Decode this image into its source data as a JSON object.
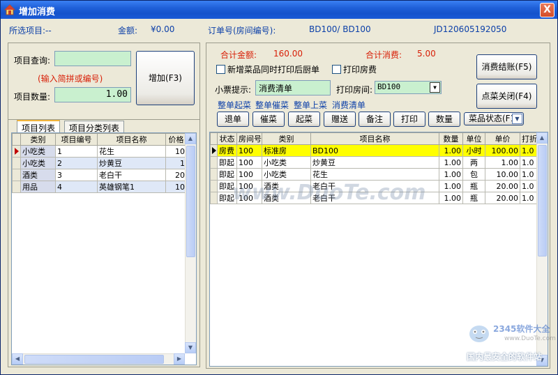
{
  "window": {
    "title": "增加消费",
    "close_label": "X"
  },
  "info": {
    "selected_item_label": "所选项目:--",
    "amount_label": "金额:",
    "amount_value": "¥0.00",
    "order_label": "订单号(房间编号):",
    "order_room": "BD100/ BD100",
    "order_id": "JD120605192050"
  },
  "left": {
    "query_label": "项目查询:",
    "query_value": "",
    "hint": "(输入简拼或编号)",
    "qty_label": "项目数量:",
    "qty_value": "1.00",
    "add_button": "增加(F3)",
    "tabs": [
      "项目列表",
      "项目分类列表"
    ],
    "columns": [
      "类别",
      "项目编号",
      "项目名称",
      "价格"
    ],
    "rows": [
      {
        "category": "小吃类",
        "id": "1",
        "name": "花生",
        "price": "10"
      },
      {
        "category": "小吃类",
        "id": "2",
        "name": "炒黄豆",
        "price": "1"
      },
      {
        "category": "酒类",
        "id": "3",
        "name": "老白干",
        "price": "20"
      },
      {
        "category": "用品",
        "id": "4",
        "name": "英雄钢笔1",
        "price": "10"
      }
    ]
  },
  "right": {
    "total_amount_label": "合计金额:",
    "total_amount_value": "160.00",
    "total_consume_label": "合计消费:",
    "total_consume_value": "5.00",
    "checkout_button": "消费结账(F5)",
    "close_menu_button": "点菜关闭(F4)",
    "print_after_kitchen_label": "新增菜品同时打印后厨单",
    "print_room_fee_label": "打印房费",
    "ticket_label": "小票提示:",
    "ticket_value": "消费清单",
    "print_room_label": "打印房间:",
    "print_room_value": "BD100",
    "links": [
      "整单起菜",
      "整单催菜",
      "整单上菜",
      "消费清单"
    ],
    "actions": [
      "退单",
      "催菜",
      "起菜",
      "赠送",
      "备注",
      "打印",
      "数量"
    ],
    "dish_state_label": "菜品状态(F1)",
    "columns": [
      "状态",
      "房间号",
      "类别",
      "项目名称",
      "数量",
      "单位",
      "单价",
      "打折"
    ],
    "rows": [
      {
        "status": "房费",
        "room": "100",
        "category": "标准房",
        "name": "BD100",
        "qty": "1.00",
        "unit": "小时",
        "price": "100.00",
        "discount": "1.0"
      },
      {
        "status": "即起",
        "room": "100",
        "category": "小吃类",
        "name": "炒黄豆",
        "qty": "1.00",
        "unit": "两",
        "price": "1.00",
        "discount": "1.0"
      },
      {
        "status": "即起",
        "room": "100",
        "category": "小吃类",
        "name": "花生",
        "qty": "1.00",
        "unit": "包",
        "price": "10.00",
        "discount": "1.0"
      },
      {
        "status": "即起",
        "room": "100",
        "category": "酒类",
        "name": "老白干",
        "qty": "1.00",
        "unit": "瓶",
        "price": "20.00",
        "discount": "1.0"
      },
      {
        "status": "即起",
        "room": "100",
        "category": "酒类",
        "name": "老白干",
        "qty": "1.00",
        "unit": "瓶",
        "price": "20.00",
        "discount": "1.0"
      }
    ]
  },
  "watermarks": {
    "center": "www.DuoTe.com",
    "brand": "2345软件大全",
    "brand_url": "www.DuoTe.com",
    "slogan": "国内最安全的软件站"
  }
}
